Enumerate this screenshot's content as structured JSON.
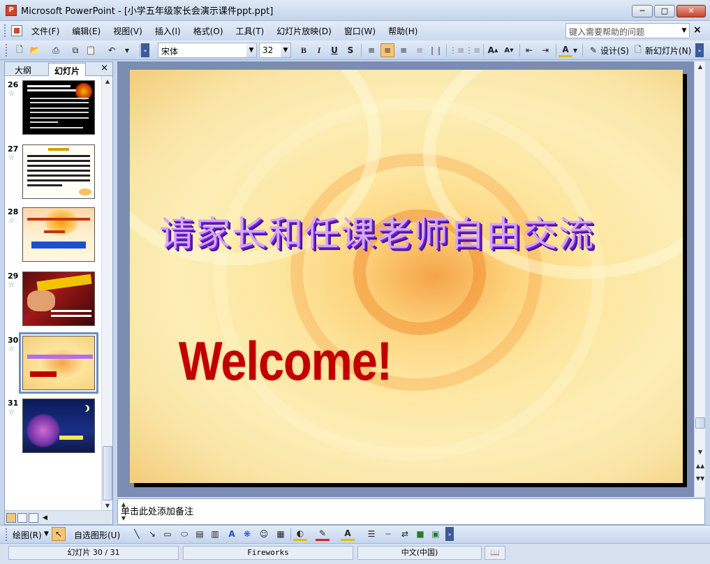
{
  "window": {
    "title": "Microsoft PowerPoint - [小学五年级家长会演示课件ppt.ppt]",
    "app_icon": "P"
  },
  "menu": [
    "文件(F)",
    "编辑(E)",
    "视图(V)",
    "插入(I)",
    "格式(O)",
    "工具(T)",
    "幻灯片放映(D)",
    "窗口(W)",
    "帮助(H)"
  ],
  "help": {
    "placeholder": "键入需要帮助的问题"
  },
  "toolbar": {
    "font": "宋体",
    "size": "32",
    "design": "设计(S)",
    "new_slide": "新幻灯片(N)"
  },
  "panel": {
    "tab_outline": "大纲",
    "tab_slides": "幻灯片",
    "close": "×",
    "thumbnails": [
      {
        "num": "26",
        "selected": false
      },
      {
        "num": "27",
        "selected": false
      },
      {
        "num": "28",
        "selected": false
      },
      {
        "num": "29",
        "selected": false
      },
      {
        "num": "30",
        "selected": true
      },
      {
        "num": "31",
        "selected": false
      }
    ]
  },
  "slide": {
    "title_cn": "请家长和任课老师自由交流",
    "welcome": "Welcome!"
  },
  "notes": {
    "placeholder": "单击此处添加备注"
  },
  "drawbar": {
    "draw": "绘图(R)",
    "autoshapes": "自选图形(U)"
  },
  "status": {
    "slide": "幻灯片 30 / 31",
    "template": "Fireworks",
    "language": "中文(中国)"
  }
}
